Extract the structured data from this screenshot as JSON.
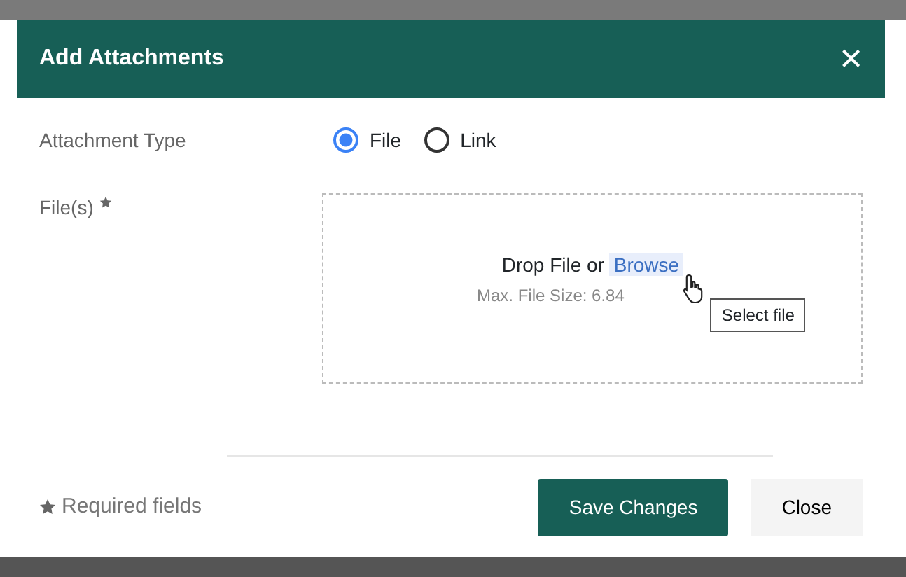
{
  "dialog": {
    "title": "Add Attachments",
    "close_icon": "×"
  },
  "attachment_type": {
    "label": "Attachment Type",
    "options": [
      {
        "label": "File",
        "selected": true
      },
      {
        "label": "Link",
        "selected": false
      }
    ]
  },
  "files": {
    "label": "File(s)",
    "required": true,
    "drop_text": "Drop File or",
    "browse_link": "Browse",
    "max_size": "Max. File Size: 6.84",
    "tooltip": "Select file"
  },
  "footer": {
    "required_note": "Required fields",
    "buttons": [
      {
        "label": "Save Changes",
        "kind": "primary"
      },
      {
        "label": "Close",
        "kind": "secondary"
      }
    ]
  }
}
